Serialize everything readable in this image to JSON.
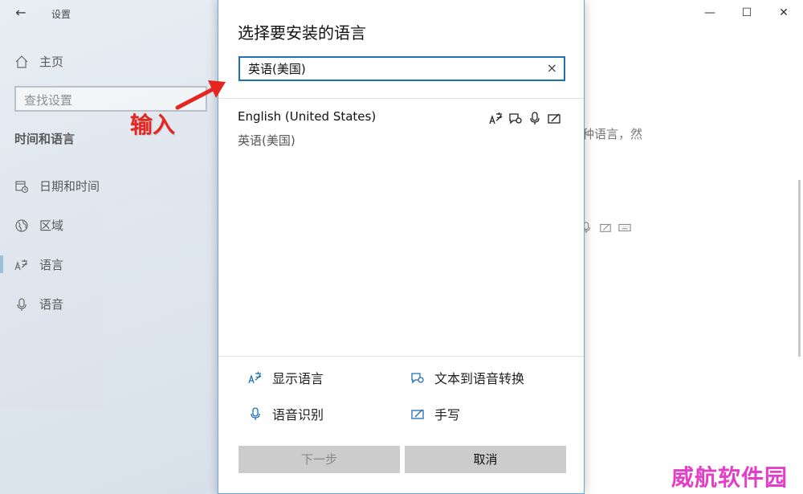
{
  "settings_window": {
    "title": "设置",
    "nav": {
      "home": "主页",
      "search_placeholder": "查找设置",
      "section": "时间和语言",
      "items": [
        {
          "label": "日期和时间",
          "icon": "calendar-clock-icon"
        },
        {
          "label": "区域",
          "icon": "globe-icon"
        },
        {
          "label": "语言",
          "icon": "language-icon",
          "active": true
        },
        {
          "label": "语音",
          "icon": "microphone-icon"
        }
      ]
    },
    "partial_text": "种语言，然",
    "window_controls": {
      "minimize": "—",
      "maximize": "☐",
      "close": "✕"
    }
  },
  "dialog": {
    "title": "选择要安装的语言",
    "search_value": "英语(美国)",
    "clear_icon": "×",
    "results": [
      {
        "name": "English (United States)",
        "native": "英语(美国)"
      }
    ],
    "legend": {
      "display_language": "显示语言",
      "text_to_speech": "文本到语音转换",
      "speech_recognition": "语音识别",
      "handwriting": "手写"
    },
    "buttons": {
      "next": "下一步",
      "cancel": "取消"
    }
  },
  "annotation": {
    "text": "输入",
    "color": "#e52520"
  },
  "watermark": {
    "text": "威航软件园",
    "color": "#e43ec9"
  },
  "colors": {
    "accent": "#1f6fb4",
    "button_bg": "#cccccc"
  }
}
